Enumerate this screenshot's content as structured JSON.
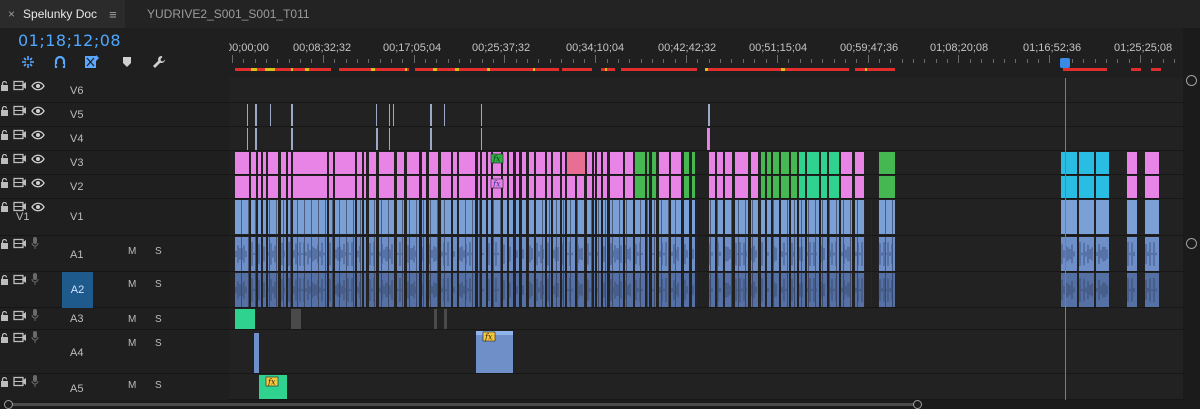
{
  "tabs": {
    "active": {
      "label": "Spelunky Doc",
      "close": "×",
      "menu": "≡"
    },
    "second": {
      "label": "YUDRIVE2_S001_S001_T011"
    }
  },
  "timecode": "01;18;12;08",
  "toolbar": {
    "icons": [
      "snap-icon",
      "linked-selection-icon",
      "add-marker-icon",
      "marker-icon",
      "wrench-icon"
    ]
  },
  "ruler": {
    "labels": [
      "00;00;00",
      "00;08;32;32",
      "00;17;05;04",
      "00;25;37;32",
      "00;34;10;04",
      "00;42;42;32",
      "00;51;15;04",
      "00;59;47;36",
      "01;08;20;08",
      "01;16;52;36",
      "01;25;25;08"
    ]
  },
  "tracks": {
    "video": [
      {
        "name": "V6",
        "source": ""
      },
      {
        "name": "V5",
        "source": ""
      },
      {
        "name": "V4",
        "source": ""
      },
      {
        "name": "V3",
        "source": ""
      },
      {
        "name": "V2",
        "source": ""
      },
      {
        "name": "V1",
        "source": "V1"
      }
    ],
    "audio": [
      {
        "name": "A1",
        "m": "M",
        "s": "S"
      },
      {
        "name": "A2",
        "m": "M",
        "s": "S"
      },
      {
        "name": "A3",
        "m": "M",
        "s": "S"
      },
      {
        "name": "A4",
        "m": "M",
        "s": "S"
      },
      {
        "name": "A5",
        "m": "M",
        "s": "S"
      }
    ]
  },
  "clips": {
    "fx_label": "fx"
  },
  "colors": {
    "accent": "#4ea8ff",
    "video_pink": "#e784e6",
    "video_green_dark": "#46b852",
    "video_green_light": "#2fd38f",
    "video_cyan": "#29bde4",
    "video_blue": "#7aa0d6",
    "audio_blue": "#6e8fc7",
    "audio_green": "#2fd38f",
    "render_red": "#e32c2c",
    "render_yellow": "#d4c21a"
  }
}
